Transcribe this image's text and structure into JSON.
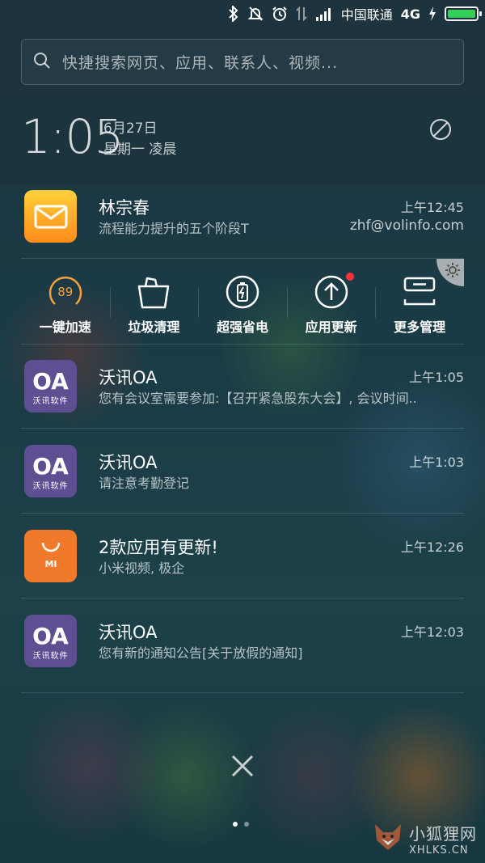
{
  "status_bar": {
    "carrier": "中国联通",
    "network": "4G",
    "battery_level": 1.0,
    "icons": [
      "bluetooth-icon",
      "mute-icon",
      "alarm-icon",
      "data-transfer-icon",
      "signal-icon",
      "charging-icon",
      "battery-icon"
    ]
  },
  "search": {
    "placeholder": "快捷搜索网页、应用、联系人、视频..."
  },
  "clock": {
    "time": "1:05",
    "date": "6月27日",
    "weekday": "星期一 凌晨"
  },
  "notifications_top": [
    {
      "app": "mail",
      "icon": "mail-icon",
      "title": "林宗春",
      "text": "流程能力提升的五个阶段T",
      "time": "上午12:45",
      "account": "zhf@volinfo.com",
      "color": "#ffb52a"
    }
  ],
  "tools": {
    "items": [
      {
        "label": "一键加速",
        "icon": "speed-gauge-icon",
        "value": "89"
      },
      {
        "label": "垃圾清理",
        "icon": "trash-bag-icon"
      },
      {
        "label": "超强省电",
        "icon": "battery-saver-icon"
      },
      {
        "label": "应用更新",
        "icon": "update-arrow-icon",
        "badge": true
      },
      {
        "label": "更多管理",
        "icon": "manage-icon"
      }
    ],
    "settings_icon": "gear-icon"
  },
  "notifications": [
    {
      "app": "oa",
      "icon_text": "OA",
      "icon_sub": "沃讯软件",
      "title": "沃讯OA",
      "text": "您有会议室需要参加:【召开紧急股东大会】, 会议时间..",
      "time": "上午1:05"
    },
    {
      "app": "oa",
      "icon_text": "OA",
      "icon_sub": "沃讯软件",
      "title": "沃讯OA",
      "text": "请注意考勤登记",
      "time": "上午1:03"
    },
    {
      "app": "mi",
      "icon_text": "MI",
      "title": "2款应用有更新!",
      "text": "小米视频, 极企",
      "time": "上午12:26"
    },
    {
      "app": "oa",
      "icon_text": "OA",
      "icon_sub": "沃讯软件",
      "title": "沃讯OA",
      "text": "您有新的通知公告[关于放假的通知]",
      "time": "上午12:03"
    }
  ],
  "pager": {
    "pages": 2,
    "active": 0
  },
  "watermark": {
    "cn": "小狐狸网",
    "en": "XHLKS.CN"
  }
}
